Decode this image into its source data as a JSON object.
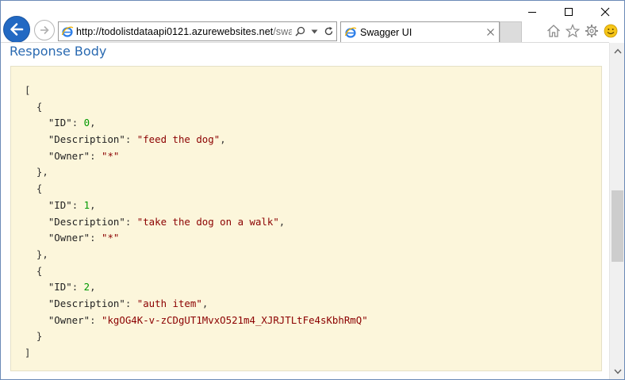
{
  "browser": {
    "address_host": "http://todolistdataapi0121.azurewebsites.net",
    "address_path": "/swagg",
    "tab_title": "Swagger UI"
  },
  "section": {
    "title": "Response Body"
  },
  "response_lines": [
    {
      "indent": 0,
      "parts": [
        {
          "t": "[",
          "c": "pun"
        }
      ]
    },
    {
      "indent": 1,
      "parts": [
        {
          "t": "{",
          "c": "pun"
        }
      ]
    },
    {
      "indent": 2,
      "parts": [
        {
          "t": "\"ID\"",
          "c": "k"
        },
        {
          "t": ": ",
          "c": "pun"
        },
        {
          "t": "0",
          "c": "num"
        },
        {
          "t": ",",
          "c": "pun"
        }
      ]
    },
    {
      "indent": 2,
      "parts": [
        {
          "t": "\"Description\"",
          "c": "k"
        },
        {
          "t": ": ",
          "c": "pun"
        },
        {
          "t": "\"feed the dog\"",
          "c": "str"
        },
        {
          "t": ",",
          "c": "pun"
        }
      ]
    },
    {
      "indent": 2,
      "parts": [
        {
          "t": "\"Owner\"",
          "c": "k"
        },
        {
          "t": ": ",
          "c": "pun"
        },
        {
          "t": "\"*\"",
          "c": "str"
        }
      ]
    },
    {
      "indent": 1,
      "parts": [
        {
          "t": "},",
          "c": "pun"
        }
      ]
    },
    {
      "indent": 1,
      "parts": [
        {
          "t": "{",
          "c": "pun"
        }
      ]
    },
    {
      "indent": 2,
      "parts": [
        {
          "t": "\"ID\"",
          "c": "k"
        },
        {
          "t": ": ",
          "c": "pun"
        },
        {
          "t": "1",
          "c": "num"
        },
        {
          "t": ",",
          "c": "pun"
        }
      ]
    },
    {
      "indent": 2,
      "parts": [
        {
          "t": "\"Description\"",
          "c": "k"
        },
        {
          "t": ": ",
          "c": "pun"
        },
        {
          "t": "\"take the dog on a walk\"",
          "c": "str"
        },
        {
          "t": ",",
          "c": "pun"
        }
      ]
    },
    {
      "indent": 2,
      "parts": [
        {
          "t": "\"Owner\"",
          "c": "k"
        },
        {
          "t": ": ",
          "c": "pun"
        },
        {
          "t": "\"*\"",
          "c": "str"
        }
      ]
    },
    {
      "indent": 1,
      "parts": [
        {
          "t": "},",
          "c": "pun"
        }
      ]
    },
    {
      "indent": 1,
      "parts": [
        {
          "t": "{",
          "c": "pun"
        }
      ]
    },
    {
      "indent": 2,
      "parts": [
        {
          "t": "\"ID\"",
          "c": "k"
        },
        {
          "t": ": ",
          "c": "pun"
        },
        {
          "t": "2",
          "c": "num"
        },
        {
          "t": ",",
          "c": "pun"
        }
      ]
    },
    {
      "indent": 2,
      "parts": [
        {
          "t": "\"Description\"",
          "c": "k"
        },
        {
          "t": ": ",
          "c": "pun"
        },
        {
          "t": "\"auth item\"",
          "c": "str"
        },
        {
          "t": ",",
          "c": "pun"
        }
      ]
    },
    {
      "indent": 2,
      "parts": [
        {
          "t": "\"Owner\"",
          "c": "k"
        },
        {
          "t": ": ",
          "c": "pun"
        },
        {
          "t": "\"kgOG4K-v-zCDgUT1MvxO521m4_XJRJTLtFe4sKbhRmQ\"",
          "c": "str"
        }
      ]
    },
    {
      "indent": 1,
      "parts": [
        {
          "t": "}",
          "c": "pun"
        }
      ]
    },
    {
      "indent": 0,
      "parts": [
        {
          "t": "]",
          "c": "pun"
        }
      ]
    }
  ],
  "colors": {
    "accent": "#2269c3",
    "title": "#2a6ab1",
    "response_bg": "#fcf6db",
    "string": "#8b0000",
    "number": "#009900"
  },
  "icons": [
    "minimize-icon",
    "maximize-icon",
    "close-icon",
    "back-arrow-icon",
    "forward-arrow-icon",
    "ie-logo-icon",
    "search-icon",
    "dropdown-icon",
    "refresh-icon",
    "tab-close-icon",
    "home-icon",
    "favorites-star-icon",
    "settings-gear-icon",
    "smiley-feedback-icon",
    "scroll-up-icon",
    "scroll-down-icon"
  ]
}
